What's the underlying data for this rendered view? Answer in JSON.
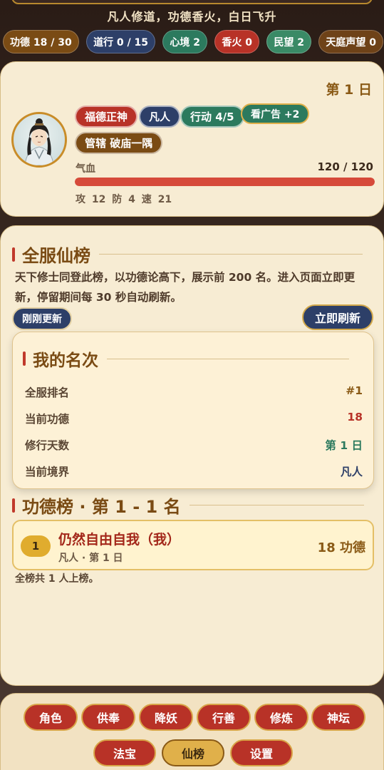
{
  "header": {
    "subtitle": "凡人修道，功德香火，白日飞升",
    "stats": [
      {
        "label": "功德 18 / 30",
        "color": "#7a4b14"
      },
      {
        "label": "道行 0 / 15",
        "color": "#2d3f68"
      },
      {
        "label": "心境 2",
        "color": "#2c7a5e"
      },
      {
        "label": "香火 0",
        "color": "#b83227"
      },
      {
        "label": "民望 2",
        "color": "#3a8a66"
      },
      {
        "label": "天庭声望 0",
        "color": "#6e4218"
      }
    ]
  },
  "character": {
    "day": "第 1 日",
    "avatar_icon": "portrait-cultivator",
    "tags": {
      "deity": "福德正神",
      "realm": "凡人",
      "action": "行动 4/5",
      "ad_button": "看广告 +2",
      "jurisdiction": "管辖 破庙一隅"
    },
    "hp_label": "气血",
    "hp_value": "120 / 120",
    "hp_fraction": 1.0,
    "combat": "攻 12  防 4  速 21"
  },
  "board": {
    "title": "全服仙榜",
    "description": "天下修士同登此榜，以功德论高下，展示前 200 名。进入页面立即更新，停留期间每 30 秒自动刷新。",
    "updated_label": "刚刚更新",
    "refresh_label": "立即刷新",
    "my_rank": {
      "title": "我的名次",
      "rows": [
        {
          "key": "全服排名",
          "value": "#1",
          "color": "#8a5a16"
        },
        {
          "key": "当前功德",
          "value": "18",
          "color": "#b83227"
        },
        {
          "key": "修行天数",
          "value": "第 1 日",
          "color": "#2c7a5e"
        },
        {
          "key": "当前境界",
          "value": "凡人",
          "color": "#2d3f68"
        }
      ]
    },
    "list_title": "功德榜 · 第 1 - 1 名",
    "entries": [
      {
        "rank": "1",
        "name": "仍然自由自我（我）",
        "meta": "凡人 · 第 1 日",
        "merit": "18 功德"
      }
    ],
    "total": "全榜共 1 人上榜。"
  },
  "nav": {
    "row1": [
      "角色",
      "供奉",
      "降妖",
      "行善",
      "修炼",
      "神坛"
    ],
    "row2": [
      "法宝",
      "仙榜",
      "设置"
    ],
    "active": "仙榜"
  }
}
